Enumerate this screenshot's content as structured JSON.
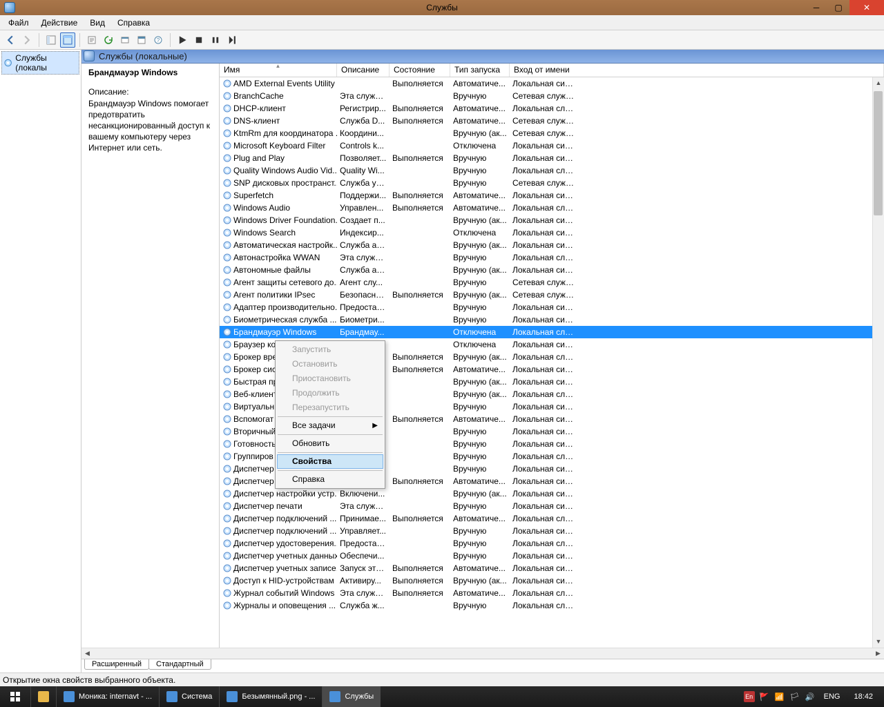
{
  "window": {
    "title": "Службы"
  },
  "menu": {
    "file": "Файл",
    "action": "Действие",
    "view": "Вид",
    "help": "Справка"
  },
  "tree": {
    "root": "Службы (локалы"
  },
  "header": {
    "label": "Службы (локальные)"
  },
  "details": {
    "selected_name": "Брандмауэр Windows",
    "desc_label": "Описание:",
    "desc_text": "Брандмауэр Windows помогает предотвратить несанкционированный доступ к вашему компьютеру через Интернет или сеть."
  },
  "columns": {
    "name": "Имя",
    "desc": "Описание",
    "state": "Состояние",
    "start": "Тип запуска",
    "logon": "Вход от имени"
  },
  "tabs": {
    "ext": "Расширенный",
    "std": "Стандартный"
  },
  "status": {
    "text": "Открытие окна свойств выбранного объекта."
  },
  "context_menu": {
    "start": "Запустить",
    "stop": "Остановить",
    "pause": "Приостановить",
    "resume": "Продолжить",
    "restart": "Перезапустить",
    "all_tasks": "Все задачи",
    "refresh": "Обновить",
    "properties": "Свойства",
    "help": "Справка"
  },
  "services": [
    {
      "name": "AMD External Events Utility",
      "desc": "",
      "state": "Выполняется",
      "start": "Автоматиче...",
      "logon": "Локальная сис..."
    },
    {
      "name": "BranchCache",
      "desc": "Эта служб...",
      "state": "",
      "start": "Вручную",
      "logon": "Сетевая служба"
    },
    {
      "name": "DHCP-клиент",
      "desc": "Регистрир...",
      "state": "Выполняется",
      "start": "Автоматиче...",
      "logon": "Локальная слу..."
    },
    {
      "name": "DNS-клиент",
      "desc": "Служба D...",
      "state": "Выполняется",
      "start": "Автоматиче...",
      "logon": "Сетевая служба"
    },
    {
      "name": "KtmRm для координатора ...",
      "desc": "Координи...",
      "state": "",
      "start": "Вручную (ак...",
      "logon": "Сетевая служба"
    },
    {
      "name": "Microsoft Keyboard Filter",
      "desc": "Controls k...",
      "state": "",
      "start": "Отключена",
      "logon": "Локальная сис..."
    },
    {
      "name": "Plug and Play",
      "desc": "Позволяет...",
      "state": "Выполняется",
      "start": "Вручную",
      "logon": "Локальная сис..."
    },
    {
      "name": "Quality Windows Audio Vid...",
      "desc": "Quality Wi...",
      "state": "",
      "start": "Вручную",
      "logon": "Локальная слу..."
    },
    {
      "name": "SNP дисковых пространст...",
      "desc": "Служба уз...",
      "state": "",
      "start": "Вручную",
      "logon": "Сетевая служба"
    },
    {
      "name": "Superfetch",
      "desc": "Поддержи...",
      "state": "Выполняется",
      "start": "Автоматиче...",
      "logon": "Локальная сис..."
    },
    {
      "name": "Windows Audio",
      "desc": "Управлен...",
      "state": "Выполняется",
      "start": "Автоматиче...",
      "logon": "Локальная слу..."
    },
    {
      "name": "Windows Driver Foundation...",
      "desc": "Создает п...",
      "state": "",
      "start": "Вручную (ак...",
      "logon": "Локальная сис..."
    },
    {
      "name": "Windows Search",
      "desc": "Индексир...",
      "state": "",
      "start": "Отключена",
      "logon": "Локальная сис..."
    },
    {
      "name": "Автоматическая настройк...",
      "desc": "Служба ав...",
      "state": "",
      "start": "Вручную (ак...",
      "logon": "Локальная сис..."
    },
    {
      "name": "Автонастройка WWAN",
      "desc": "Эта служб...",
      "state": "",
      "start": "Вручную",
      "logon": "Локальная слу..."
    },
    {
      "name": "Автономные файлы",
      "desc": "Служба ав...",
      "state": "",
      "start": "Вручную (ак...",
      "logon": "Локальная сис..."
    },
    {
      "name": "Агент защиты сетевого до...",
      "desc": "Агент слу...",
      "state": "",
      "start": "Вручную",
      "logon": "Сетевая служба"
    },
    {
      "name": "Агент политики IPsec",
      "desc": "Безопасно...",
      "state": "Выполняется",
      "start": "Вручную (ак...",
      "logon": "Сетевая служба"
    },
    {
      "name": "Адаптер производительно...",
      "desc": "Предостав...",
      "state": "",
      "start": "Вручную",
      "logon": "Локальная сис..."
    },
    {
      "name": "Биометрическая служба ...",
      "desc": "Биометри...",
      "state": "",
      "start": "Вручную",
      "logon": "Локальная сис..."
    },
    {
      "name": "Брандмауэр Windows",
      "desc": "Брандмау...",
      "state": "",
      "start": "Отключена",
      "logon": "Локальная слу...",
      "selected": true
    },
    {
      "name": "Браузер ко",
      "desc": "",
      "state": "",
      "start": "Отключена",
      "logon": "Локальная сис..."
    },
    {
      "name": "Брокер вре",
      "desc": "",
      "state": "Выполняется",
      "start": "Вручную (ак...",
      "logon": "Локальная слу..."
    },
    {
      "name": "Брокер сис",
      "desc": "",
      "state": "Выполняется",
      "start": "Автоматиче...",
      "logon": "Локальная сис..."
    },
    {
      "name": "Быстрая пр",
      "desc": "",
      "state": "",
      "start": "Вручную (ак...",
      "logon": "Локальная сис..."
    },
    {
      "name": "Веб-клиент",
      "desc": "",
      "state": "",
      "start": "Вручную (ак...",
      "logon": "Локальная слу..."
    },
    {
      "name": "Виртуальн",
      "desc": "",
      "state": "",
      "start": "Вручную",
      "logon": "Локальная сис..."
    },
    {
      "name": "Вспомогат",
      "desc": "",
      "state": "Выполняется",
      "start": "Автоматиче...",
      "logon": "Локальная сис..."
    },
    {
      "name": "Вторичный",
      "desc": "",
      "state": "",
      "start": "Вручную",
      "logon": "Локальная сис..."
    },
    {
      "name": "Готовность",
      "desc": "",
      "state": "",
      "start": "Вручную",
      "logon": "Локальная сис..."
    },
    {
      "name": "Группиров",
      "desc": "",
      "state": "",
      "start": "Вручную",
      "logon": "Локальная слу..."
    },
    {
      "name": "Диспетчер",
      "desc": "",
      "state": "",
      "start": "Вручную",
      "logon": "Локальная сис..."
    },
    {
      "name": "Диспетчер",
      "desc": "",
      "state": "Выполняется",
      "start": "Автоматиче...",
      "logon": "Локальная сис..."
    },
    {
      "name": "Диспетчер настройки устр...",
      "desc": "Включени...",
      "state": "",
      "start": "Вручную (ак...",
      "logon": "Локальная сис..."
    },
    {
      "name": "Диспетчер печати",
      "desc": "Эта служб...",
      "state": "",
      "start": "Вручную",
      "logon": "Локальная сис..."
    },
    {
      "name": "Диспетчер подключений ...",
      "desc": "Принимае...",
      "state": "Выполняется",
      "start": "Автоматиче...",
      "logon": "Локальная слу..."
    },
    {
      "name": "Диспетчер подключений ...",
      "desc": "Управляет...",
      "state": "",
      "start": "Вручную",
      "logon": "Локальная сис..."
    },
    {
      "name": "Диспетчер удостоверения...",
      "desc": "Предостав...",
      "state": "",
      "start": "Вручную",
      "logon": "Локальная слу..."
    },
    {
      "name": "Диспетчер учетных данных",
      "desc": "Обеспечи...",
      "state": "",
      "start": "Вручную",
      "logon": "Локальная сис..."
    },
    {
      "name": "Диспетчер учетных записе...",
      "desc": "Запуск это...",
      "state": "Выполняется",
      "start": "Автоматиче...",
      "logon": "Локальная сис..."
    },
    {
      "name": "Доступ к HID-устройствам",
      "desc": "Активиру...",
      "state": "Выполняется",
      "start": "Вручную (ак...",
      "logon": "Локальная сис..."
    },
    {
      "name": "Журнал событий Windows",
      "desc": "Эта служб...",
      "state": "Выполняется",
      "start": "Автоматиче...",
      "logon": "Локальная слу..."
    },
    {
      "name": "Журналы и оповещения ...",
      "desc": "Служба ж...",
      "state": "",
      "start": "Вручную",
      "logon": "Локальная слу..."
    }
  ],
  "taskbar": {
    "items": [
      {
        "label": "Моника: internavt - ..."
      },
      {
        "label": "Система"
      },
      {
        "label": "Безымянный.png - ..."
      },
      {
        "label": "Службы",
        "active": true
      }
    ],
    "lang_indicator": "En",
    "lang": "ENG",
    "clock": "18:42"
  }
}
